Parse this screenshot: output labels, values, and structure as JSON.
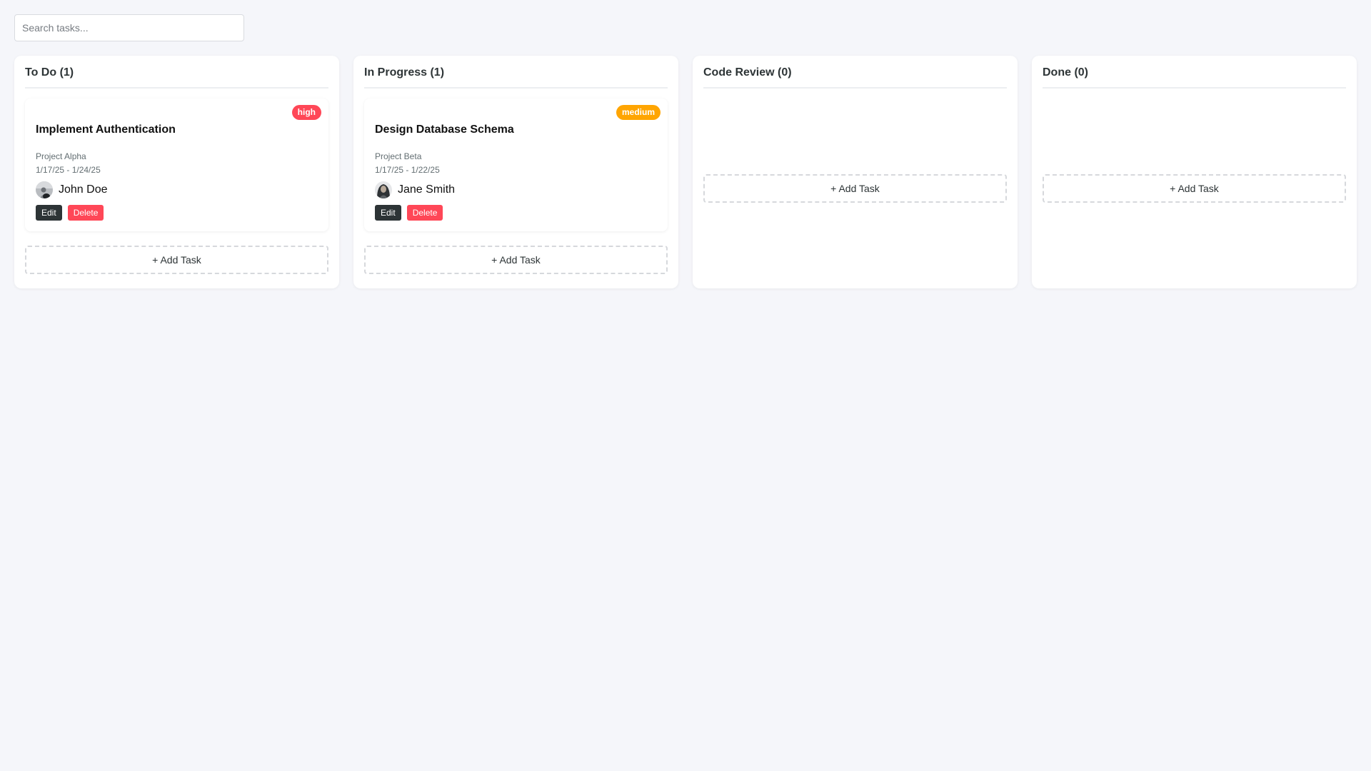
{
  "search": {
    "placeholder": "Search tasks..."
  },
  "colors": {
    "high": "#ff4757",
    "medium": "#ffa502",
    "edit": "#2d3436",
    "delete": "#ff4757"
  },
  "columns": [
    {
      "title": "To Do (1)",
      "add_label": "+ Add Task",
      "tasks": [
        {
          "priority": "high",
          "title": "Implement Authentication",
          "project": "Project Alpha",
          "dates": "1/17/25 - 1/24/25",
          "assignee": "John Doe",
          "edit_label": "Edit",
          "delete_label": "Delete"
        }
      ]
    },
    {
      "title": "In Progress (1)",
      "add_label": "+ Add Task",
      "tasks": [
        {
          "priority": "medium",
          "title": "Design Database Schema",
          "project": "Project Beta",
          "dates": "1/17/25 - 1/22/25",
          "assignee": "Jane Smith",
          "edit_label": "Edit",
          "delete_label": "Delete"
        }
      ]
    },
    {
      "title": "Code Review (0)",
      "add_label": "+ Add Task",
      "tasks": []
    },
    {
      "title": "Done (0)",
      "add_label": "+ Add Task",
      "tasks": []
    }
  ]
}
